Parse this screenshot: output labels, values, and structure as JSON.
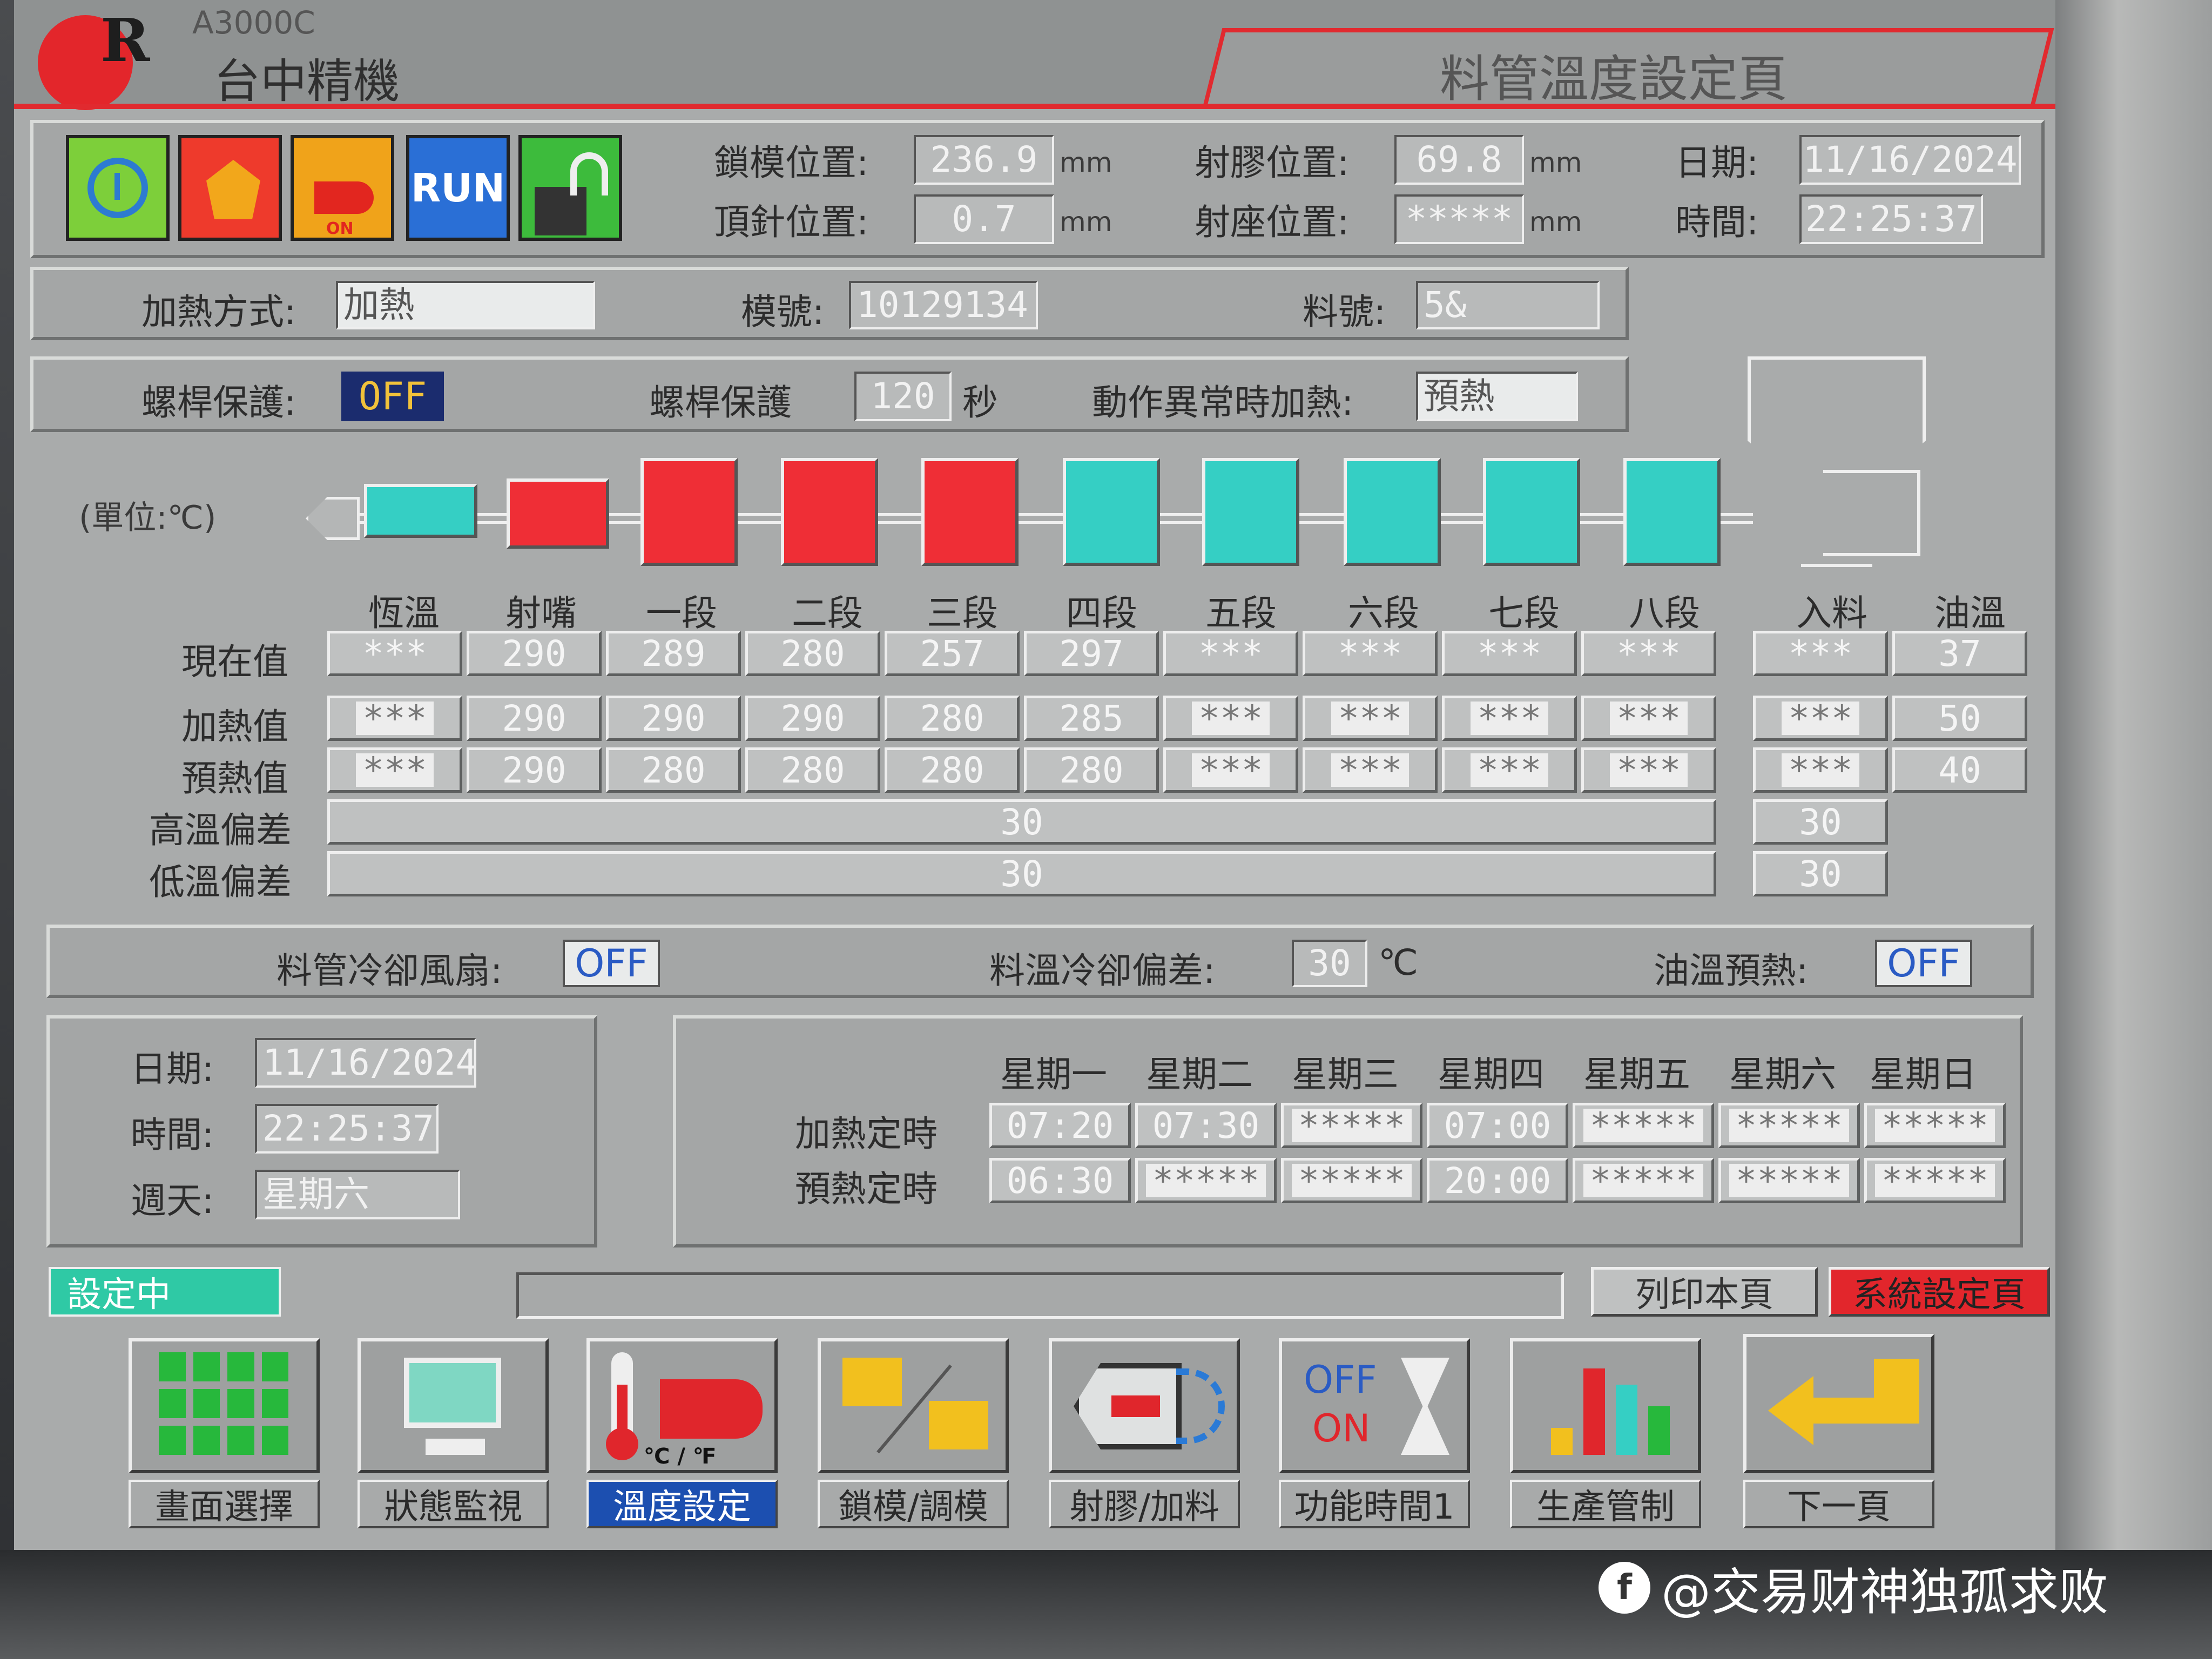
{
  "brand": {
    "model": "A3000C",
    "company": "台中精機"
  },
  "page_title": "料管溫度設定頁",
  "status_icons": [
    {
      "name": "clock-icon"
    },
    {
      "name": "mold-icon"
    },
    {
      "name": "heater-icon",
      "sub": "ON"
    },
    {
      "name": "run-icon",
      "label": "RUN"
    },
    {
      "name": "unlock-icon"
    }
  ],
  "header": {
    "clamp_pos_label": "鎖模位置:",
    "clamp_pos_value": "236.9",
    "clamp_pos_unit": "mm",
    "ejector_pos_label": "頂針位置:",
    "ejector_pos_value": "0.7",
    "ejector_pos_unit": "mm",
    "inject_pos_label": "射膠位置:",
    "inject_pos_value": "69.8",
    "inject_pos_unit": "mm",
    "carriage_pos_label": "射座位置:",
    "carriage_pos_value": "*****",
    "carriage_pos_unit": "mm",
    "date_label": "日期:",
    "date_value": "11/16/2024",
    "time_label": "時間:",
    "time_value": "22:25:37"
  },
  "info_row": {
    "heat_mode_label": "加熱方式:",
    "heat_mode_value": "加熱",
    "mold_no_label": "模號:",
    "mold_no_value": "10129134",
    "material_no_label": "料號:",
    "material_no_value": "5&"
  },
  "protect_row": {
    "screw_protect_label": "螺桿保護:",
    "screw_protect_value": "OFF",
    "screw_protect_time_label": "螺桿保護",
    "screw_protect_time_value": "120",
    "screw_protect_time_unit": "秒",
    "fault_heat_label": "動作異常時加熱:",
    "fault_heat_value": "預熱"
  },
  "unit_label": "(單位:℃)",
  "zones": {
    "headers": [
      "恆溫",
      "射嘴",
      "一段",
      "二段",
      "三段",
      "四段",
      "五段",
      "六段",
      "七段",
      "八段"
    ],
    "extra_headers": [
      "入料",
      "油溫"
    ],
    "row_labels": [
      "現在值",
      "加熱值",
      "預熱值",
      "高溫偏差",
      "低溫偏差"
    ],
    "current": [
      "***",
      "290",
      "289",
      "280",
      "257",
      "297",
      "***",
      "***",
      "***",
      "***"
    ],
    "heat": [
      "***",
      "290",
      "290",
      "290",
      "280",
      "285",
      "***",
      "***",
      "***",
      "***"
    ],
    "preheat": [
      "***",
      "290",
      "280",
      "280",
      "280",
      "280",
      "***",
      "***",
      "***",
      "***"
    ],
    "extra_current": [
      "***",
      "37"
    ],
    "extra_heat": [
      "***",
      "50"
    ],
    "extra_preheat": [
      "***",
      "40"
    ],
    "high_dev": "30",
    "low_dev": "30",
    "extra_high_dev": "30",
    "extra_low_dev": "30",
    "block_colors": [
      "cyan",
      "red",
      "red",
      "red",
      "red",
      "cyan",
      "cyan",
      "cyan",
      "cyan",
      "cyan"
    ]
  },
  "cooling_row": {
    "fan_label": "料管冷卻風扇:",
    "fan_value": "OFF",
    "cool_dev_label": "料溫冷卻偏差:",
    "cool_dev_value": "30",
    "cool_dev_unit": "℃",
    "oil_preheat_label": "油溫預熱:",
    "oil_preheat_value": "OFF"
  },
  "clock": {
    "date_label": "日期:",
    "date_value": "11/16/2024",
    "time_label": "時間:",
    "time_value": "22:25:37",
    "weekday_label": "週天:",
    "weekday_value": "星期六"
  },
  "schedule": {
    "days": [
      "星期一",
      "星期二",
      "星期三",
      "星期四",
      "星期五",
      "星期六",
      "星期日"
    ],
    "heat_label": "加熱定時",
    "preheat_label": "預熱定時",
    "heat_times": [
      "07:20",
      "07:30",
      "*****",
      "07:00",
      "*****",
      "*****",
      "*****"
    ],
    "preheat_times": [
      "06:30",
      "*****",
      "*****",
      "20:00",
      "*****",
      "*****",
      "*****"
    ]
  },
  "status_bar": {
    "state": "設定中",
    "message": "",
    "print_label": "列印本頁",
    "system_label": "系統設定頁"
  },
  "nav": [
    {
      "name": "screen-select",
      "label": "畫面選擇",
      "icon": "grid-icon"
    },
    {
      "name": "status-monitor",
      "label": "狀態監視",
      "icon": "monitor-icon"
    },
    {
      "name": "temp-setting",
      "label": "溫度設定",
      "icon": "thermometer-icon",
      "icon_text": "℃ / ℉",
      "active": true
    },
    {
      "name": "clamp-adjust",
      "label": "鎖模/調模",
      "icon": "clamp-icon"
    },
    {
      "name": "inject-charge",
      "label": "射膠/加料",
      "icon": "inject-icon"
    },
    {
      "name": "function-time",
      "label": "功能時間1",
      "icon": "hourglass-icon",
      "icon_text_off": "OFF",
      "icon_text_on": "ON"
    },
    {
      "name": "production-control",
      "label": "生產管制",
      "icon": "bar-chart-icon"
    },
    {
      "name": "next-page",
      "label": "下一頁",
      "icon": "enter-arrow-icon"
    }
  ],
  "watermark": "@交易财神独孤求败"
}
